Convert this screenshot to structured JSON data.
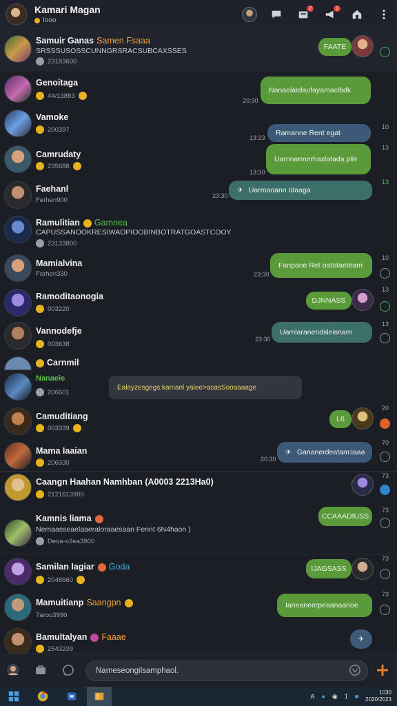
{
  "header": {
    "title": "Kamari Magan",
    "subtitle": "Iooo",
    "badges": [
      "2",
      "1"
    ]
  },
  "chats": [
    {
      "name": "Samuir Ganas",
      "tag": "Samen Fsaaa",
      "tag_color": "#f0a23a",
      "preview": "SRSSSUSOSSCUNNGRSRACSUBCAXSSES",
      "meta": "23183600",
      "bubble": "FAATE",
      "bubble_time": "",
      "right_time": "",
      "status": "ok"
    },
    {
      "name": "Genoitaga",
      "tag": "",
      "tag_color": "",
      "preview": "",
      "meta": "44/13883",
      "bubble": "Nanaelardaufayamaclbdk",
      "bubble_time": "20:30",
      "right_time": "",
      "status": "ok"
    },
    {
      "name": "Vamoke",
      "tag": "",
      "tag_color": "",
      "preview": "",
      "meta": "200397",
      "bubble": "Ramanne Rent egat",
      "bubble_time": "13:23",
      "right_time": "10",
      "status": ""
    },
    {
      "name": "Camrudaty",
      "tag": "",
      "tag_color": "",
      "preview": "",
      "meta": "235688",
      "bubble": "Uarnnarmerhaxlatada plis",
      "bubble_time": "13:30",
      "right_time": "13",
      "status": ""
    },
    {
      "name": "Faehanl",
      "tag": "",
      "tag_color": "",
      "preview": "",
      "meta": "Ferhen900",
      "bubble": "Uarmaoann Idaaga",
      "bubble_time": "23:30",
      "right_time": "13",
      "status": ""
    },
    {
      "name": "Ramulitian",
      "tag": "Gamnea",
      "tag_color": "#5bbf4a",
      "preview": "CAPUSSANOOKRESIWAOPIOOBINBOTRATGOASTCOOY",
      "meta": "23133800",
      "bubble": "",
      "bubble_time": "",
      "right_time": "",
      "status": ""
    },
    {
      "name": "Mamialvina",
      "tag": "",
      "tag_color": "",
      "preview": "",
      "meta": "Forhen330",
      "bubble": "Fanpane Ret oatotaeteam",
      "bubble_time": "23:30",
      "right_time": "10",
      "status": "ok"
    },
    {
      "name": "Ramoditaonogia",
      "tag": "",
      "tag_color": "",
      "preview": "",
      "meta": "003220",
      "bubble": "DJNNASS",
      "bubble_time": "",
      "right_time": "13",
      "status": "ok"
    },
    {
      "name": "Vannodefje",
      "tag": "",
      "tag_color": "",
      "preview": "",
      "meta": "003638",
      "bubble": "Uamlaranendsleisnam",
      "bubble_time": "23:30",
      "right_time": "13",
      "status": ""
    },
    {
      "name": "Carnmil",
      "tag": "",
      "tag_color": "",
      "preview": "",
      "meta": "",
      "bubble": "",
      "bubble_time": "",
      "right_time": "",
      "status": ""
    },
    {
      "name": "Nanaeie",
      "tag": "",
      "tag_color": "",
      "preview": "",
      "meta": "206601",
      "bubble": "Ealeyzesgegs:kamanl yalee>acasSooaaaage",
      "bubble_time": "",
      "right_time": "",
      "status": ""
    },
    {
      "name": "Camuditiang",
      "tag": "",
      "tag_color": "",
      "preview": "",
      "meta": "003339",
      "bubble": "L6",
      "bubble_time": "",
      "right_time": "20",
      "status": "warn"
    },
    {
      "name": "Mama Iaaian",
      "tag": "",
      "tag_color": "",
      "preview": "",
      "meta": "206330",
      "bubble": "Gananerdeatam:iaaa",
      "bubble_time": "20:30",
      "right_time": "70",
      "status": ""
    },
    {
      "name": "Caangn Haahan Namhban (A0003 2213Ha0)",
      "tag": "",
      "tag_color": "",
      "preview": "",
      "meta": "2121613900",
      "bubble": "",
      "bubble_time": "",
      "right_time": "73",
      "status": "blue"
    },
    {
      "name": "Kamnis liama",
      "tag": "",
      "tag_color": "",
      "preview": "Nemaasseaelaaeraloraaesaan Fennt 6N4haon )",
      "meta": "Deoa-o3ea3900",
      "bubble": "CCAAADIUSS",
      "bubble_time": "",
      "right_time": "73",
      "status": ""
    },
    {
      "name": "Samilan Iagiar",
      "tag": "Goda",
      "tag_color": "#3ab0e0",
      "preview": "",
      "meta": "2048660",
      "bubble": "IJAGSASS",
      "bubble_time": "",
      "right_time": "73",
      "status": ""
    },
    {
      "name": "Mamuitianp",
      "tag": "Saangpn",
      "tag_color": "#f0a23a",
      "preview": "",
      "meta": "7aroo3990",
      "bubble": "Ianeaneerpeaanaanoe",
      "bubble_time": "",
      "right_time": "73",
      "status": ""
    },
    {
      "name": "Bamultalyan",
      "tag": "Faaae",
      "tag_color": "#f0a23a",
      "preview": "",
      "meta": "2543239",
      "bubble": "",
      "bubble_time": "",
      "right_time": "",
      "status": ""
    }
  ],
  "composer": {
    "placeholder": "Nameseongilsamphaol."
  },
  "taskbar": {
    "tray_text": "A",
    "tray_count": "1",
    "clock_time": "1030",
    "clock_date": "2020/2023"
  }
}
